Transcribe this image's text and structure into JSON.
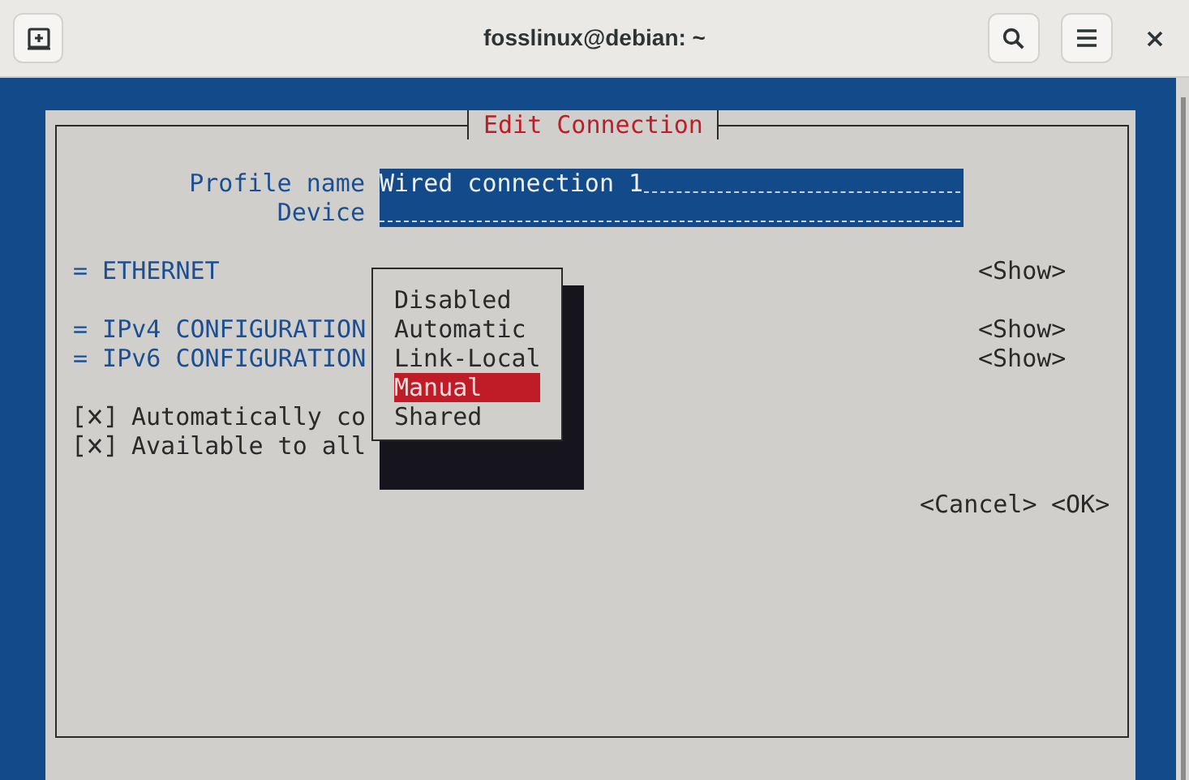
{
  "window": {
    "title": "fosslinux@debian: ~"
  },
  "dialog": {
    "title": "Edit Connection",
    "fields": [
      {
        "label": "Profile name",
        "value": "Wired connection 1"
      },
      {
        "label": "Device"
      }
    ],
    "sections": [
      {
        "label": "= ETHERNET",
        "action": "<Show>"
      },
      {
        "label": "= IPv4 CONFIGURATION",
        "action": "<Show>"
      },
      {
        "label": "= IPv6 CONFIGURATION",
        "action": "<Show>"
      }
    ],
    "checkboxes": [
      {
        "label": "Automatically co",
        "checked": true
      },
      {
        "label": "Available to all",
        "checked": true
      }
    ],
    "buttons": [
      "<Cancel>",
      "<OK>"
    ]
  },
  "popup": {
    "items": [
      {
        "label": "Disabled",
        "selected": false
      },
      {
        "label": "Automatic",
        "selected": false
      },
      {
        "label": "Link-Local",
        "selected": false
      },
      {
        "label": "Manual",
        "selected": true
      },
      {
        "label": "Shared",
        "selected": false
      }
    ]
  }
}
